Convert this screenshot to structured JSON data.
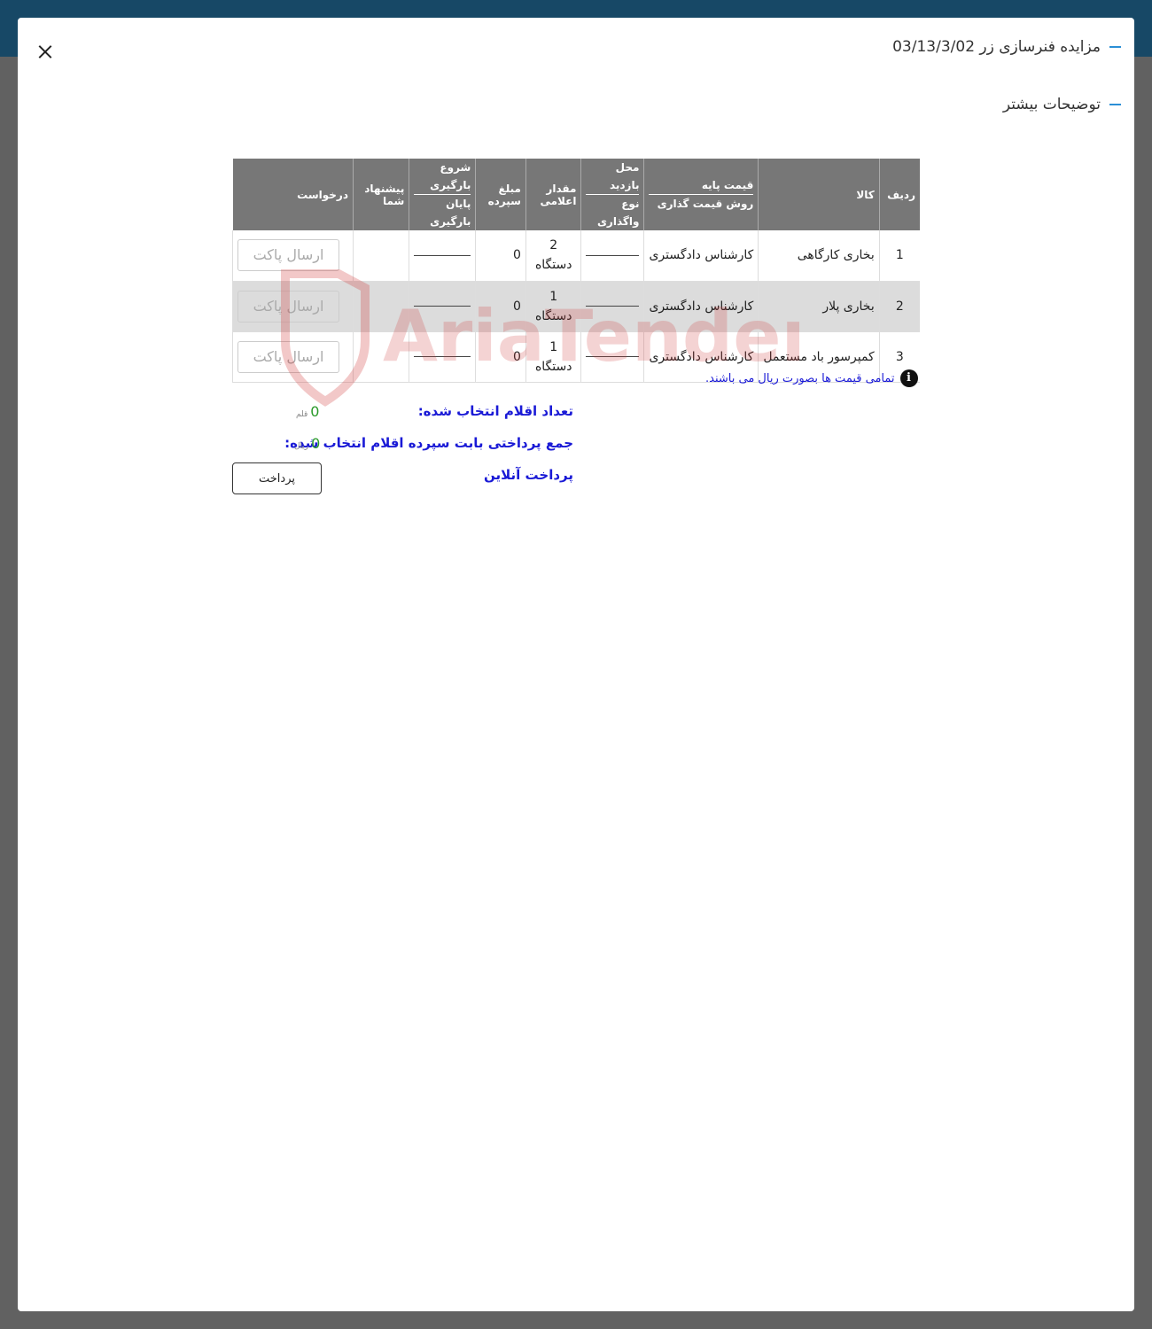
{
  "modal": {
    "title": "مزایده فنرسازی زر 03/13/3/02",
    "more_details": "توضیحات بیشتر"
  },
  "table": {
    "headers": {
      "row": "ردیف",
      "item": "کالا",
      "base_price": "قیمت پایه",
      "pricing_method": "روش قیمت گذاری",
      "visit_location": "محل بازدید",
      "assignment_type": "نوع واگذاری",
      "declared_quantity": "مقدار اعلامی",
      "deposit_amount": "مبلغ سپرده",
      "loading_start": "شروع بارگیری",
      "loading_end": "پایان بارگیری",
      "your_offer": "پیشنهاد شما",
      "request": "درخواست"
    },
    "rows": [
      {
        "num": "1",
        "item": "بخاری کارگاهی",
        "pricing": "کارشناس دادگستری",
        "qty": "2",
        "unit": "دستگاه",
        "deposit": "0",
        "button": "ارسال پاکت"
      },
      {
        "num": "2",
        "item": "بخاری پلار",
        "pricing": "کارشناس دادگستری",
        "qty": "1",
        "unit": "دستگاه",
        "deposit": "0",
        "button": "ارسال پاکت"
      },
      {
        "num": "3",
        "item": "کمپرسور باد مستعمل",
        "pricing": "کارشناس دادگستری",
        "qty": "1",
        "unit": "دستگاه",
        "deposit": "0",
        "button": "ارسال پاکت"
      }
    ]
  },
  "note": "تمامی قیمت ها بصورت ریال می باشند.",
  "summary": {
    "selected_count_label": "تعداد اقلام انتخاب شده:",
    "selected_count_value": "0",
    "selected_count_unit": "قلم",
    "total_payment_label": "جمع پرداختی بابت سپرده اقلام انتخاب شده:",
    "total_payment_value": "0",
    "total_payment_unit": "ریال",
    "online_payment_label": "پرداخت آنلاین",
    "pay_button": "پرداخت"
  },
  "watermark": "AriaTender.neT",
  "colors": {
    "topbar": "#174866",
    "overlay": "#616161",
    "table_header": "#777777",
    "link_blue": "#1a1ad6",
    "value_green": "#2a9a2a",
    "accent_dash": "#2b8fd6",
    "watermark_red": "#d23a3a"
  }
}
